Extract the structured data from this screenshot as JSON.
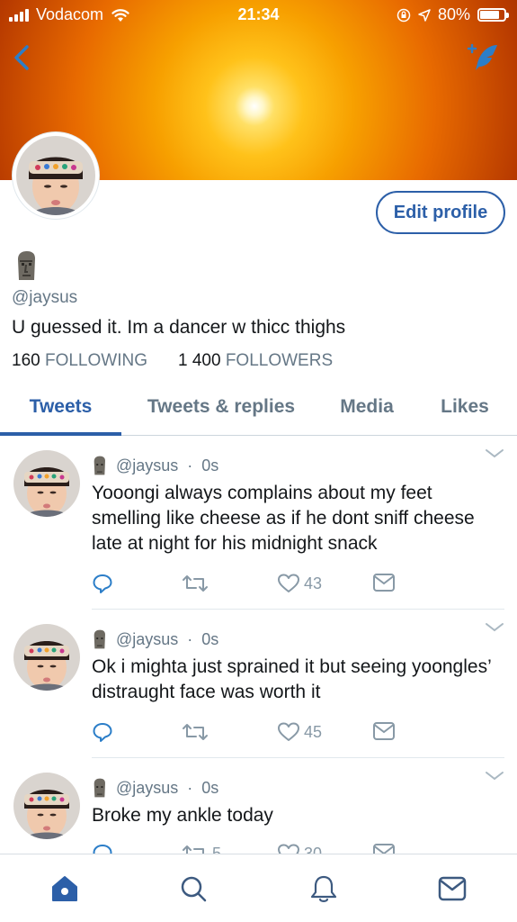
{
  "status_bar": {
    "carrier": "Vodacom",
    "time": "21:34",
    "battery": "80%",
    "battery_level": 0.8
  },
  "colors": {
    "accent": "#2c5fa8",
    "muted": "#657786",
    "icon_gray": "#8899a6"
  },
  "profile": {
    "handle": "@jaysus",
    "bio": "U guessed it. Im a dancer w thicc thighs",
    "following_count": "160",
    "following_label": "FOLLOWING",
    "followers_count": "1 400",
    "followers_label": "FOLLOWERS",
    "edit_label": "Edit profile",
    "name_emoji": "moai-icon"
  },
  "tabs": [
    {
      "label": "Tweets",
      "active": true
    },
    {
      "label": "Tweets & replies",
      "active": false
    },
    {
      "label": "Media",
      "active": false
    },
    {
      "label": "Likes",
      "active": false
    }
  ],
  "tweets": [
    {
      "handle": "@jaysus",
      "time": "0s",
      "text": "Yooongi always complains about my feet smelling like cheese as if he dont sniff cheese late at night for his midnight snack",
      "retweets": "",
      "likes": "43"
    },
    {
      "handle": "@jaysus",
      "time": "0s",
      "text": "Ok i mighta just sprained it but seeing yoongles’ distraught face was worth it",
      "retweets": "",
      "likes": "45"
    },
    {
      "handle": "@jaysus",
      "time": "0s",
      "text": "Broke my ankle today",
      "retweets": "5",
      "likes": "30"
    }
  ],
  "bottom_nav": [
    "home-icon",
    "search-icon",
    "notifications-icon",
    "messages-icon"
  ]
}
